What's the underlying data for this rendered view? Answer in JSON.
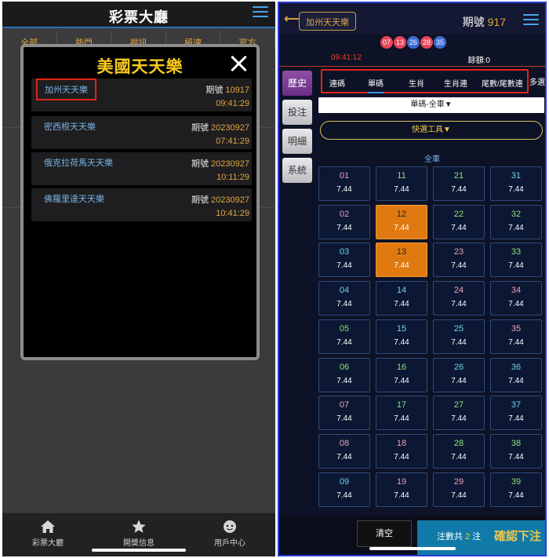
{
  "left": {
    "title": "彩票大廳",
    "categories": [
      "全部",
      "熱門",
      "視訊",
      "極速",
      "官方"
    ],
    "modal": {
      "title": "美國天天樂",
      "items": [
        {
          "name": "加州天天樂",
          "period_label": "期號",
          "period": "10917",
          "time": "09:41:29"
        },
        {
          "name": "密西根天天樂",
          "period_label": "期號",
          "period": "20230927",
          "time": "07:41:29"
        },
        {
          "name": "俄克拉荷馬天天樂",
          "period_label": "期號",
          "period": "20230927",
          "time": "10:11:29"
        },
        {
          "name": "佛羅里達天天樂",
          "period_label": "期號",
          "period": "20230927",
          "time": "10:41:29"
        }
      ]
    },
    "tabbar": [
      {
        "label": "彩票大廳",
        "icon": "home-icon"
      },
      {
        "label": "開獎信息",
        "icon": "star-icon"
      },
      {
        "label": "用戶中心",
        "icon": "user-icon"
      }
    ]
  },
  "right": {
    "lottery": "加州天天樂",
    "period_label": "期號",
    "period": "917",
    "balls": [
      {
        "n": "07",
        "color": "red"
      },
      {
        "n": "13",
        "color": "red"
      },
      {
        "n": "26",
        "color": "blue"
      },
      {
        "n": "28",
        "color": "red"
      },
      {
        "n": "35",
        "color": "blue"
      }
    ],
    "timer": "09:41:12",
    "balance": "餘額:0",
    "sidebar": [
      "歷史",
      "投注",
      "明細",
      "系統"
    ],
    "play_tabs": [
      "連碼",
      "單碼",
      "生肖",
      "生肖連",
      "尾數/尾數連"
    ],
    "play_more": "多選",
    "select_value": "單碼-全車▼",
    "quick_tools": "快選工具▼",
    "section_label": "全車",
    "odds": "7.44",
    "footer": {
      "clear": "清空",
      "count_prefix": "注數共",
      "count": "2",
      "count_suffix": "注",
      "confirm": "確認下注"
    }
  }
}
